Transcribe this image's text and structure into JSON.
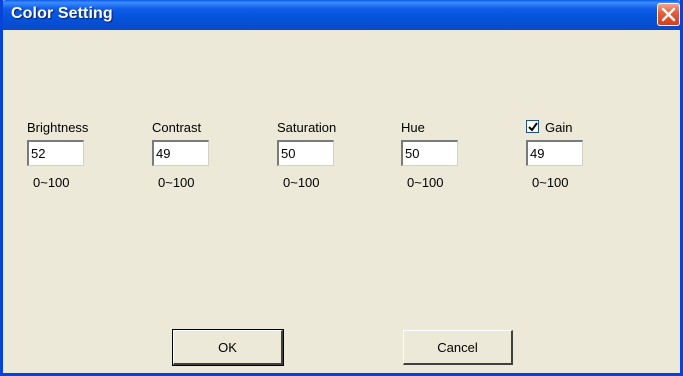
{
  "window": {
    "title": "Color Setting"
  },
  "params": {
    "brightness": {
      "label": "Brightness",
      "value": "52",
      "range": "0~100"
    },
    "contrast": {
      "label": "Contrast",
      "value": "49",
      "range": "0~100"
    },
    "saturation": {
      "label": "Saturation",
      "value": "50",
      "range": "0~100"
    },
    "hue": {
      "label": "Hue",
      "value": "50",
      "range": "0~100"
    },
    "gain": {
      "label": "Gain",
      "value": "49",
      "range": "0~100",
      "checked": true
    }
  },
  "buttons": {
    "ok": "OK",
    "cancel": "Cancel"
  },
  "colors": {
    "titlebar": "#0353DB",
    "background": "#ECE9D8",
    "close": "#D23E1C"
  },
  "icons": {
    "close": "close-icon",
    "checkmark": "checkmark-icon"
  }
}
